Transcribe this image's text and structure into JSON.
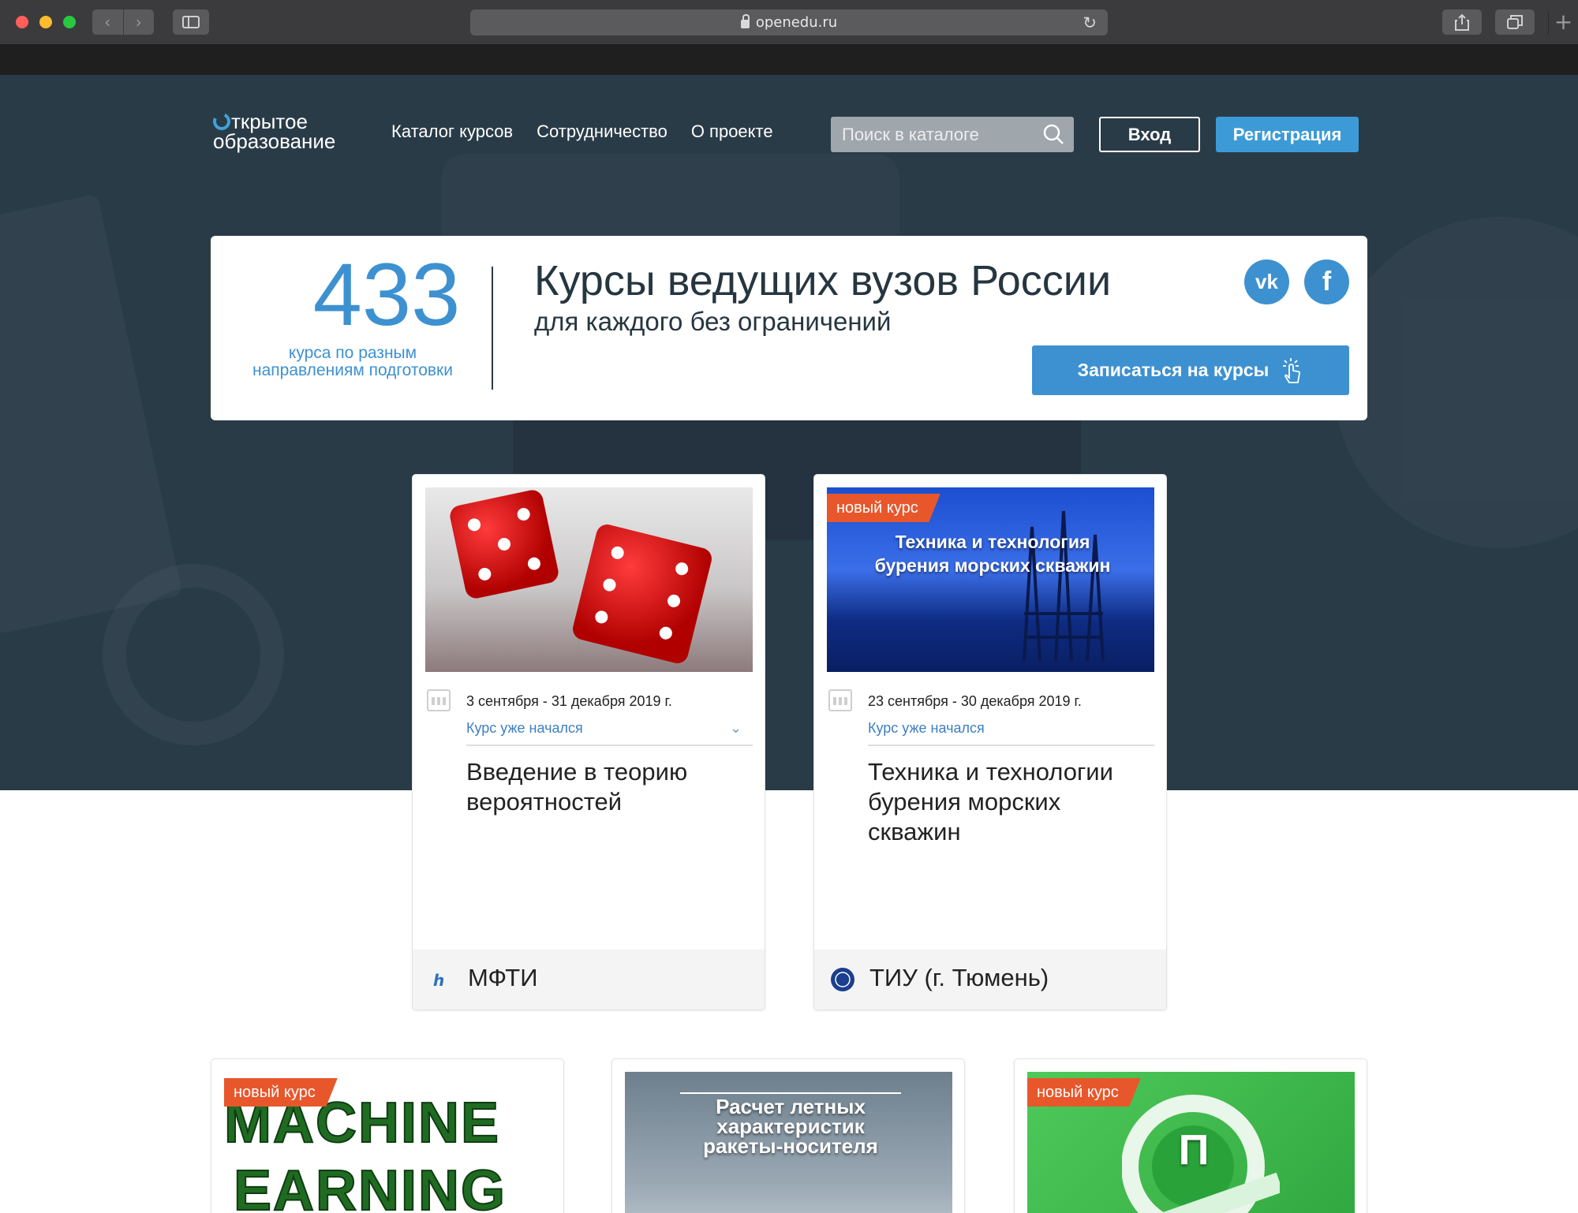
{
  "browser": {
    "url": "openedu.ru",
    "icons": {
      "back": "chevron-left-icon",
      "forward": "chevron-right-icon",
      "sidebar": "sidebar-icon",
      "lock": "lock-icon",
      "reload": "reload-icon",
      "share": "share-icon",
      "tabs": "tabs-icon",
      "new_tab": "plus-icon"
    }
  },
  "header": {
    "logo_line1": "ткрытое",
    "logo_line2": "образование",
    "nav": [
      "Каталог курсов",
      "Сотрудничество",
      "О проекте"
    ],
    "search_placeholder": "Поиск в каталоге",
    "login_label": "Вход",
    "register_label": "Регистрация"
  },
  "promo": {
    "count": "433",
    "count_label": "курса по разным направлениям подготовки",
    "headline": "Курсы ведущих вузов России",
    "subline": "для каждого без ограничений",
    "social": {
      "vk": "vk",
      "fb": "f"
    },
    "enroll_label": "Записаться на курсы"
  },
  "courses": [
    {
      "tag": "",
      "dates": "3 сентября - 31 декабря 2019 г.",
      "status": "Курс уже начался",
      "title": "Введение в теорию вероятностей",
      "university": "МФТИ"
    },
    {
      "tag": "новый курс",
      "thumb_text": "Техника и технология бурения морских скважин",
      "dates": "23 сентября - 30 декабря 2019 г.",
      "status": "Курс уже начался",
      "title": "Техника и технологии бурения морских скважин",
      "university": "ТИУ (г. Тюмень)"
    }
  ],
  "bottom_courses": [
    {
      "tag": "новый курс",
      "thumb_line1": "MACHINE",
      "thumb_line2": "EARNING"
    },
    {
      "tag": "",
      "thumb_text": "Расчет летных характеристик ракеты-носителя"
    },
    {
      "tag": "новый курс",
      "thumb_symbol": "П"
    }
  ],
  "colors": {
    "accent": "#3d91d0",
    "hero_bg": "#2a3b48",
    "tag": "#e8572b"
  }
}
